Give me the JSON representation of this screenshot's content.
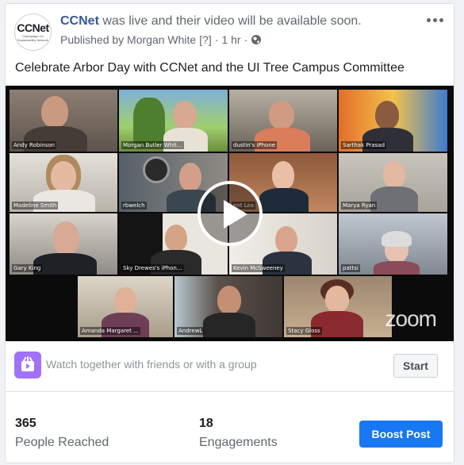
{
  "post": {
    "page_name": "CCNet",
    "live_text": " was live and their video will be available soon.",
    "published_by": "Published by Morgan White",
    "bracket_note": "[?]",
    "separator": "·",
    "time": "1 hr",
    "separator2": "·",
    "body": "Celebrate Arbor Day with CCNet and the UI Tree Campus Committee"
  },
  "avatar": {
    "logo_text": "CCNet",
    "logo_sub": "Champaign Co Sustainability Network"
  },
  "video": {
    "participants": [
      "Andy Robinson",
      "Morgan Butler Whit...",
      "dustin's iPhone",
      "Sarthak Prasad",
      "Madeline Smith",
      "rbwelch",
      "ent Lea",
      "Marya Ryan",
      "Gary King",
      "Sky Drewes's iPhon...",
      "Kevin McSweeney",
      "pattsi",
      "Amanda Margaret ...",
      "AndrewL",
      "Stacy Gloss"
    ],
    "watermark": "zoom"
  },
  "watch": {
    "text": "Watch together with friends or with a group",
    "button": "Start"
  },
  "stats": {
    "reached_value": "365",
    "reached_label": "People Reached",
    "engagements_value": "18",
    "engagements_label": "Engagements",
    "boost_label": "Boost Post"
  },
  "colors": {
    "link": "#365899",
    "boost": "#1877f2",
    "active_speaker": "#7dd03c",
    "watch_icon": "#a371f7"
  }
}
